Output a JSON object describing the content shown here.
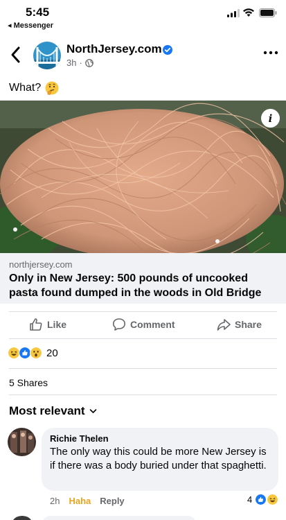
{
  "status_bar": {
    "time": "5:45",
    "back_app": "◂ Messenger"
  },
  "post": {
    "page_name": "NorthJersey.com",
    "time_ago": "3h",
    "separator": "·",
    "caption": "What?",
    "caption_emoji": "thinking-face-icon"
  },
  "link_preview": {
    "domain": "northjersey.com",
    "headline": "Only in New Jersey: 500 pounds of uncooked pasta found dumped in the woods in Old Bridge"
  },
  "actions": {
    "like": "Like",
    "comment": "Comment",
    "share": "Share"
  },
  "reactions": {
    "icons": [
      "haha-icon",
      "like-icon",
      "wow-icon"
    ],
    "count": "20"
  },
  "shares": "5 Shares",
  "sort": {
    "label": "Most relevant"
  },
  "comments": [
    {
      "author": "Richie Thelen",
      "text": "The only way this could be more New Jersey is if there was a body buried under that spaghetti.",
      "time": "2h",
      "reaction_label": "Haha",
      "reply_label": "Reply",
      "reaction_count": "4"
    }
  ],
  "colors": {
    "accent": "#1877f2",
    "haha": "#e7a41f",
    "muted": "#65676b",
    "preview_bg": "#f0f2f5"
  }
}
